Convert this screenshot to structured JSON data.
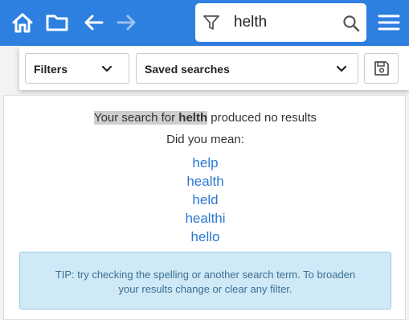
{
  "topbar": {
    "icons": {
      "home": "home-icon",
      "folder": "folder-icon",
      "back": "arrow-left-icon",
      "forward": "arrow-right-icon",
      "filter": "filter-icon",
      "search": "search-icon",
      "menu": "hamburger-menu-icon"
    },
    "search_value": "helth",
    "colors": {
      "bar": "#2d7fe0",
      "forward_disabled": "#9cc2f0"
    }
  },
  "filterbar": {
    "filters_label": "Filters",
    "saved_searches_label": "Saved searches",
    "save_icon": "floppy-disk-icon"
  },
  "results": {
    "prefix": "Your search for",
    "term": "helth",
    "suffix": "produced no results",
    "did_you_mean": "Did you mean:",
    "suggestions": [
      "help",
      "health",
      "held",
      "healthi",
      "hello"
    ],
    "tip_line1": "TIP: try checking the spelling or another search term. To broaden",
    "tip_line2": "your results change or clear any filter.",
    "colors": {
      "link": "#2c78d0",
      "tip_bg": "#d0e9f7"
    }
  }
}
